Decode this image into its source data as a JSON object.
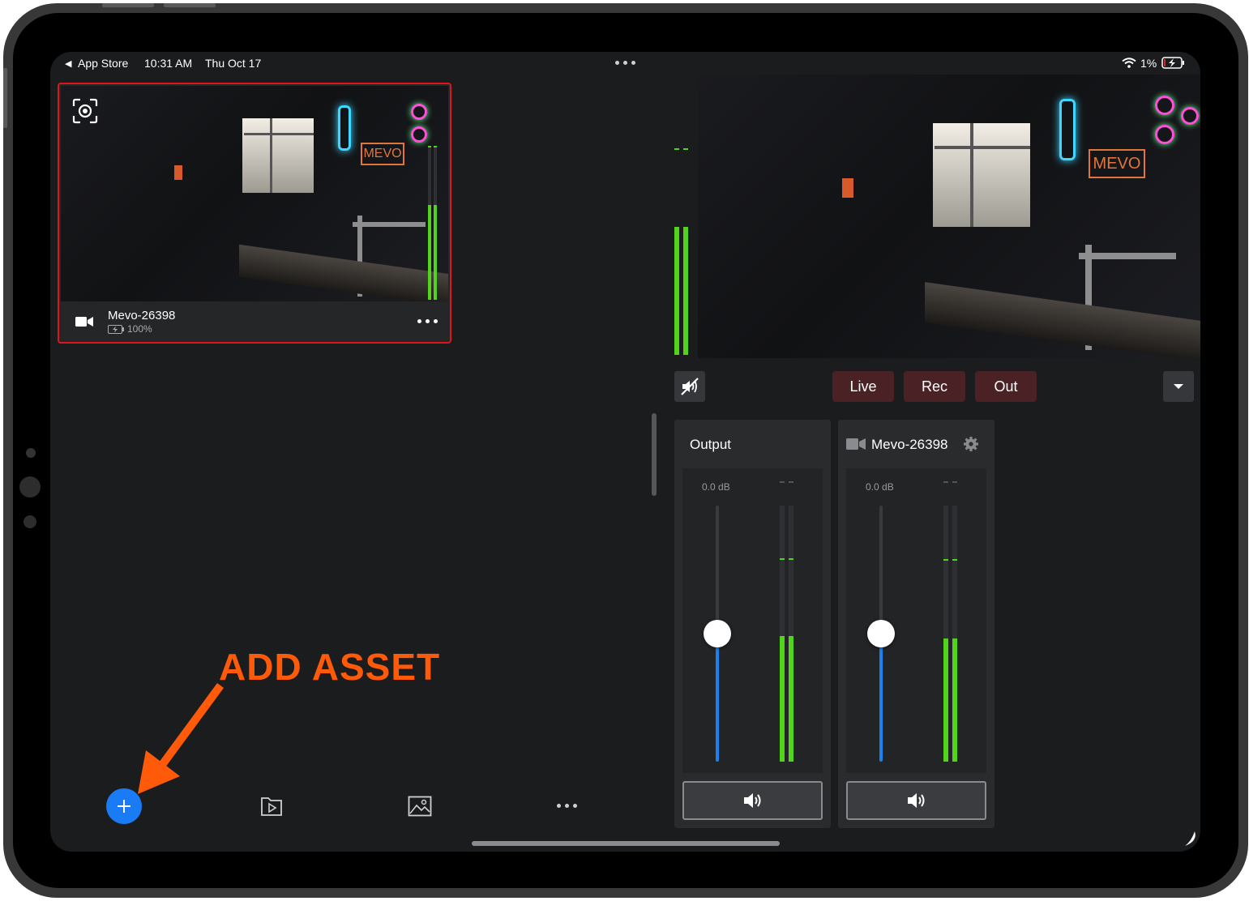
{
  "status_bar": {
    "back_label": "App Store",
    "time": "10:31 AM",
    "date": "Thu Oct 17",
    "battery": "1%"
  },
  "camera_card": {
    "name": "Mevo-26398",
    "battery": "100%",
    "selected_color": "#e0151b"
  },
  "program": {
    "live_label": "Live",
    "rec_label": "Rec",
    "out_label": "Out"
  },
  "mixer": {
    "output": {
      "title": "Output",
      "gain": "0.0 dB",
      "fader_level": 0.5,
      "meter_level": 0.5
    },
    "camera": {
      "title": "Mevo-26398",
      "gain": "0.0 dB",
      "fader_level": 0.5,
      "meter_level": 0.48
    }
  },
  "annotation": {
    "label": "ADD ASSET",
    "color": "#ff5a0a"
  },
  "toolbar": {
    "add_color": "#1a7cf5"
  },
  "colors": {
    "meter_green": "#52d41c",
    "fader_blue": "#1a82f0",
    "pill_bg": "#4a2225"
  }
}
